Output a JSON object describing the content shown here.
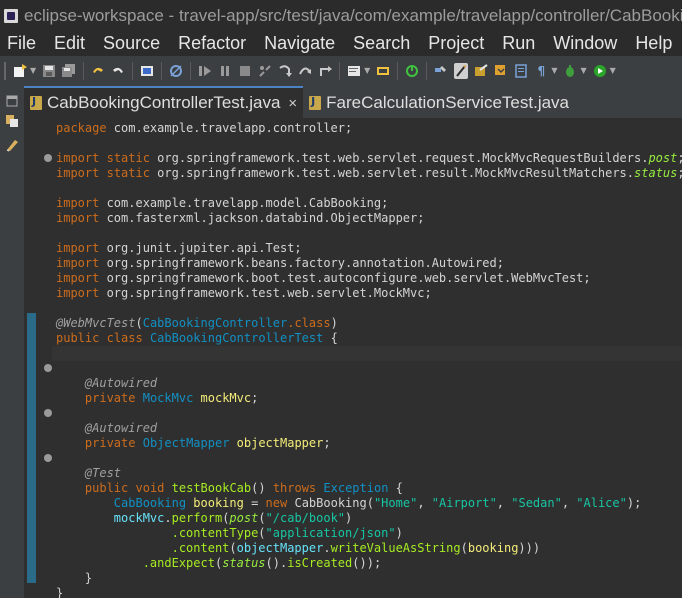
{
  "window": {
    "title": "eclipse-workspace - travel-app/src/test/java/com/example/travelapp/controller/CabBookingControllerTest.java - Eclipse IDE"
  },
  "menu": [
    "File",
    "Edit",
    "Source",
    "Refactor",
    "Navigate",
    "Search",
    "Project",
    "Run",
    "Window",
    "Help"
  ],
  "toolbar_icons": [
    "new-wizard-icon",
    "save-icon",
    "save-all-icon",
    "undo-icon",
    "redo-icon",
    "terminal-icon",
    "skip-breakpoints-icon",
    "resume-icon",
    "suspend-icon",
    "terminate-icon",
    "disconnect-icon",
    "step-into-icon",
    "step-over-icon",
    "step-return-icon",
    "open-console-icon",
    "build-icon",
    "toggle-mark-occurrences-icon",
    "highlight-icon",
    "open-type-icon",
    "open-task-icon",
    "show-whitespace-icon",
    "debug-icon",
    "run-icon"
  ],
  "left_strip_icons": [
    "minimize-icon",
    "restore-icon",
    "outline-icon"
  ],
  "tabs": [
    {
      "label": "CabBookingControllerTest.java",
      "active": true,
      "close": "×"
    },
    {
      "label": "FareCalculationServiceTest.java",
      "active": false
    }
  ],
  "code": {
    "package_kw": "package",
    "package_name": " com.example.travelapp.controller;",
    "import_kw": "import",
    "static_kw": "static",
    "imports_static": [
      {
        "prefix": " org.springframework.test.web.servlet.request.MockMvcRequestBuilders.",
        "member": "post",
        "suffix": ";"
      },
      {
        "prefix": " org.springframework.test.web.servlet.result.MockMvcResultMatchers.",
        "member": "status",
        "suffix": ";"
      }
    ],
    "imports": [
      " com.example.travelapp.model.CabBooking;",
      " com.fasterxml.jackson.databind.ObjectMapper;",
      " org.junit.jupiter.api.Test;",
      " org.springframework.beans.factory.annotation.Autowired;",
      " org.springframework.boot.test.autoconfigure.web.servlet.WebMvcTest;",
      " org.springframework.test.web.servlet.MockMvc;"
    ],
    "class_annotation": "@WebMvcTest",
    "class_annotation_arg": "CabBookingController",
    "class_kw": "class",
    "public_kw": "public",
    "class_name": "CabBookingControllerTest",
    "autowired": "@Autowired",
    "private_kw": "private",
    "field1_type": "MockMvc",
    "field1_name": "mockMvc",
    "field2_type": "ObjectMapper",
    "field2_name": "objectMapper",
    "test_annotation": "@Test",
    "void_kw": "void",
    "method_name": "testBookCab",
    "throws_kw": "throws",
    "exception_type": "Exception",
    "local_type": "CabBooking",
    "local_name": "booking",
    "new_kw": "new",
    "args": [
      "\"Home\"",
      "\"Airport\"",
      "\"Sedan\"",
      "\"Alice\""
    ],
    "perform": "perform",
    "post": "post",
    "endpoint": "\"/cab/book\"",
    "content_type_call": ".contentType",
    "content_type_value": "\"application/json\"",
    "content_call": ".content",
    "write_call": "writeValueAsString",
    "and_expect": ".andExpect",
    "status": "status",
    "is_created": "isCreated",
    "class_suffix": ".class"
  }
}
